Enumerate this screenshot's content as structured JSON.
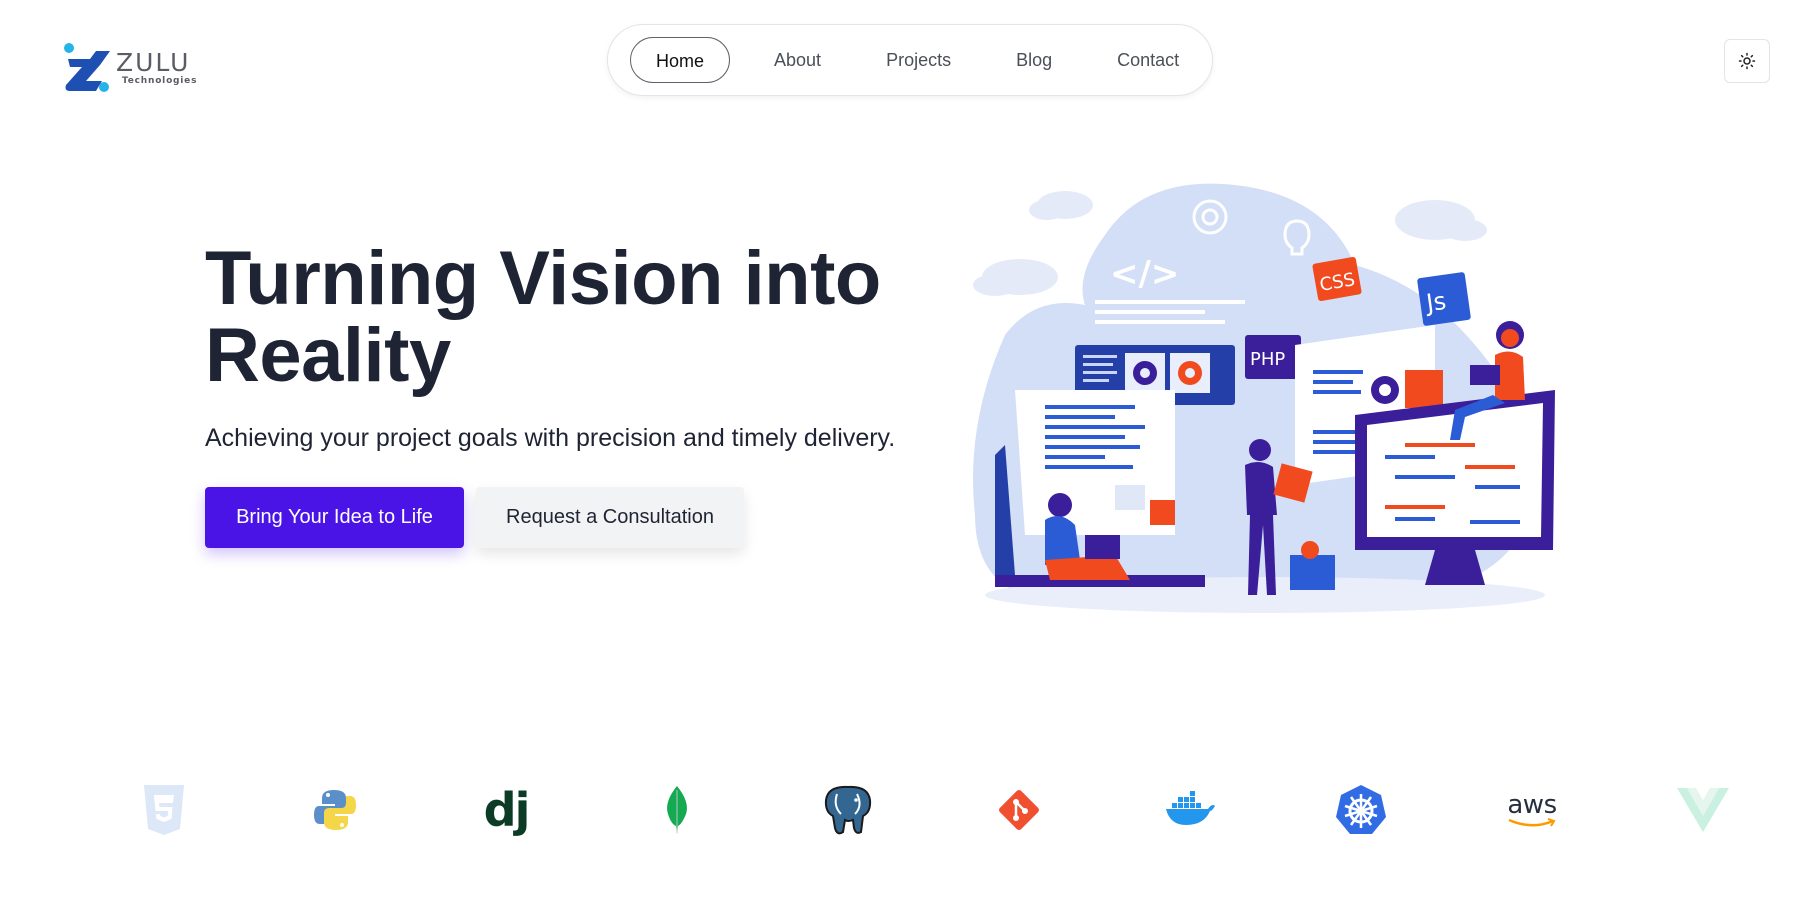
{
  "brand": {
    "name": "ZULU",
    "subtitle": "Technologies",
    "primary_color": "#4b14e6",
    "logo_blue": "#1e4fb3",
    "logo_cyan": "#26b3e8"
  },
  "nav": {
    "items": [
      {
        "label": "Home",
        "active": true
      },
      {
        "label": "About",
        "active": false
      },
      {
        "label": "Projects",
        "active": false
      },
      {
        "label": "Blog",
        "active": false
      },
      {
        "label": "Contact",
        "active": false
      }
    ]
  },
  "theme_toggle": {
    "icon": "sun-icon"
  },
  "hero": {
    "title": "Turning Vision into Reality",
    "subtitle": "Achieving your project goals with precision and timely delivery.",
    "primary_cta": "Bring Your Idea to Life",
    "secondary_cta": "Request a Consultation"
  },
  "illustration": {
    "labels": {
      "css": "CSS",
      "js": "Js",
      "php": "PHP",
      "code": "</>"
    }
  },
  "tech_logos": [
    {
      "icon": "css3-icon"
    },
    {
      "icon": "python-icon"
    },
    {
      "icon": "django-icon",
      "text": "dj"
    },
    {
      "icon": "mongodb-icon"
    },
    {
      "icon": "postgresql-icon"
    },
    {
      "icon": "git-icon"
    },
    {
      "icon": "docker-icon"
    },
    {
      "icon": "kubernetes-icon"
    },
    {
      "icon": "aws-icon",
      "text": "aws"
    },
    {
      "icon": "vue-icon"
    }
  ]
}
